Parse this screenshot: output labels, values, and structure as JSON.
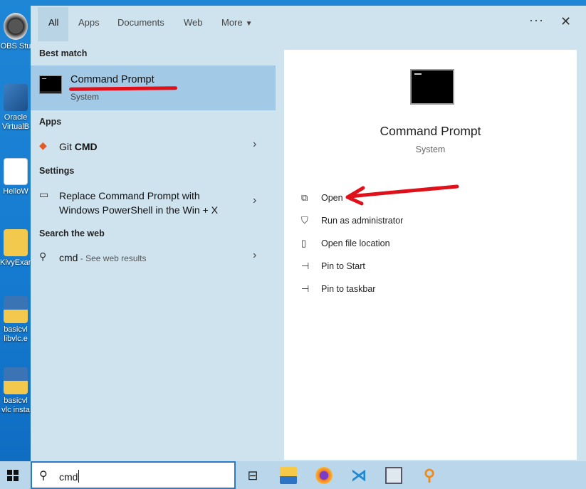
{
  "desktop": {
    "icons": [
      "OBS Stu",
      "Oracle VirtualB",
      "HelloW",
      "KivyExan",
      "basicvl libvlc.e",
      "basicvl vlc insta"
    ]
  },
  "tabs": [
    {
      "label": "All",
      "active": true
    },
    {
      "label": "Apps",
      "active": false
    },
    {
      "label": "Documents",
      "active": false
    },
    {
      "label": "Web",
      "active": false
    },
    {
      "label": "More",
      "active": false
    }
  ],
  "top_controls": {
    "more_options": "···",
    "close": "✕"
  },
  "best_match": {
    "heading": "Best match",
    "title": "Command Prompt",
    "subtitle": "System"
  },
  "apps": {
    "heading": "Apps",
    "items": [
      {
        "prefix": "Git ",
        "bold": "CMD"
      }
    ]
  },
  "settings": {
    "heading": "Settings",
    "items": [
      {
        "line1": "Replace Command Prompt with",
        "line2": "Windows PowerShell in the Win + X"
      }
    ]
  },
  "web": {
    "heading": "Search the web",
    "query": "cmd",
    "suffix": " - See web results"
  },
  "preview": {
    "title": "Command Prompt",
    "subtitle": "System",
    "actions": [
      {
        "label": "Open",
        "icon": "open-icon"
      },
      {
        "label": "Run as administrator",
        "icon": "shield-icon"
      },
      {
        "label": "Open file location",
        "icon": "file-location-icon"
      },
      {
        "label": "Pin to Start",
        "icon": "pin-icon"
      },
      {
        "label": "Pin to taskbar",
        "icon": "pin-icon"
      }
    ]
  },
  "taskbar": {
    "search_value": "cmd",
    "icons": [
      "task-view-icon",
      "file-explorer-icon",
      "firefox-icon",
      "vscode-icon",
      "monitor-app-icon",
      "search-app-icon"
    ]
  },
  "colors": {
    "annotation": "#e0101a",
    "accent": "#2b7ac4",
    "selected": "#a2cae6"
  }
}
